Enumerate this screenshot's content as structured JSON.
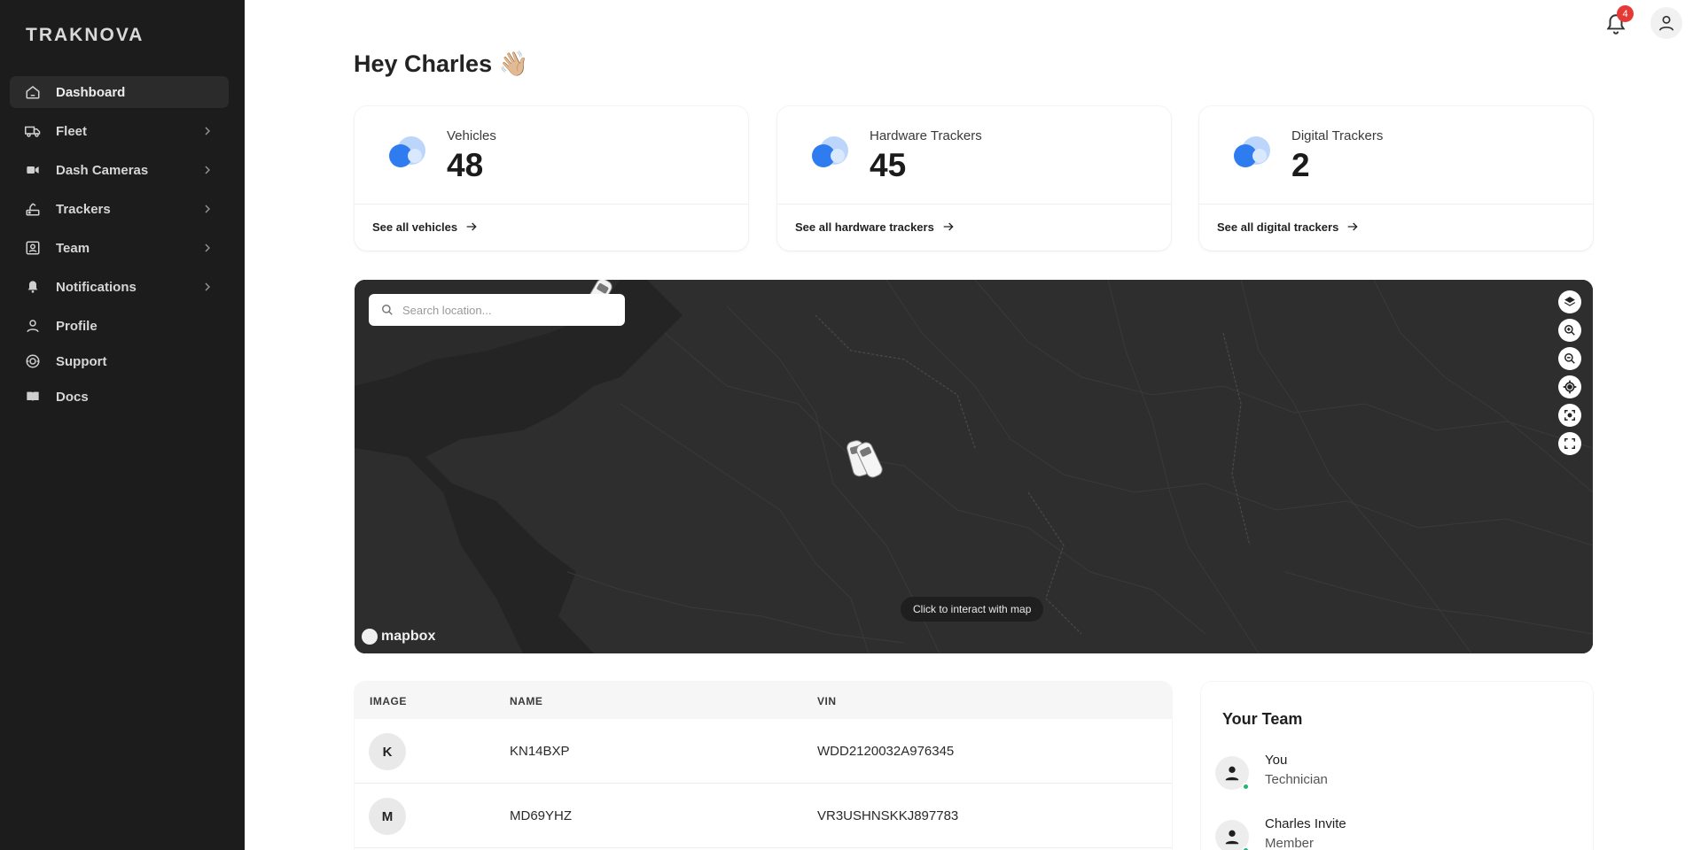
{
  "app": {
    "logo": "TRAKNOVA"
  },
  "sidebar": {
    "items": [
      {
        "label": "Dashboard",
        "icon": "home-icon",
        "active": true,
        "has_children": false
      },
      {
        "label": "Fleet",
        "icon": "truck-icon",
        "active": false,
        "has_children": true
      },
      {
        "label": "Dash Cameras",
        "icon": "video-camera-icon",
        "active": false,
        "has_children": true
      },
      {
        "label": "Trackers",
        "icon": "tracker-icon",
        "active": false,
        "has_children": true
      },
      {
        "label": "Team",
        "icon": "contact-card-icon",
        "active": false,
        "has_children": true
      },
      {
        "label": "Notifications",
        "icon": "bell-icon",
        "active": false,
        "has_children": true
      },
      {
        "label": "Profile",
        "icon": "person-icon",
        "active": false,
        "has_children": false
      },
      {
        "label": "Support",
        "icon": "support-icon",
        "active": false,
        "has_children": false
      },
      {
        "label": "Docs",
        "icon": "book-icon",
        "active": false,
        "has_children": false
      }
    ]
  },
  "header": {
    "notification_count": "4"
  },
  "greeting": "Hey Charles 👋🏼",
  "stats": [
    {
      "label": "Vehicles",
      "value": "48",
      "link": "See all vehicles"
    },
    {
      "label": "Hardware Trackers",
      "value": "45",
      "link": "See all hardware trackers"
    },
    {
      "label": "Digital Trackers",
      "value": "2",
      "link": "See all digital trackers"
    }
  ],
  "map": {
    "search_placeholder": "Search location...",
    "hint": "Click to interact with map",
    "attribution": "mapbox",
    "controls": [
      "layers-icon",
      "zoom-in-icon",
      "zoom-out-icon",
      "locate-icon",
      "focus-icon",
      "fullscreen-icon"
    ]
  },
  "vehicles_table": {
    "headers": [
      "IMAGE",
      "NAME",
      "VIN"
    ],
    "rows": [
      {
        "initial": "K",
        "name": "KN14BXP",
        "vin": "WDD2120032A976345"
      },
      {
        "initial": "M",
        "name": "MD69YHZ",
        "vin": "VR3USHNSKKJ897783"
      }
    ]
  },
  "team": {
    "title": "Your Team",
    "members": [
      {
        "name": "You",
        "role": "Technician",
        "online": true
      },
      {
        "name": "Charles Invite",
        "role": "Member",
        "online": true
      }
    ]
  },
  "colors": {
    "sidebar_bg": "#1c1c1c",
    "accent_blue": "#3b82f6",
    "badge_red": "#e53935",
    "online_green": "#22b573"
  }
}
